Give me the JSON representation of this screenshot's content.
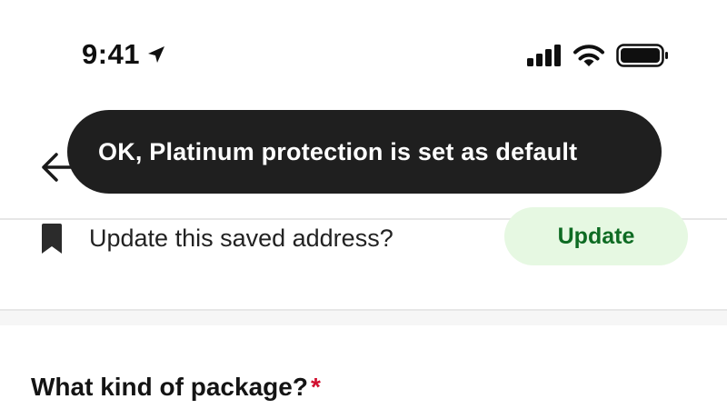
{
  "status_bar": {
    "time": "9:41",
    "icons": [
      "location-arrow-icon",
      "cellular-signal-icon",
      "wifi-icon",
      "battery-icon"
    ]
  },
  "header": {
    "back_icon": "back-arrow-icon"
  },
  "toast": {
    "message": "OK, Platinum protection is set as default"
  },
  "saved_address": {
    "icon": "bookmark-icon",
    "prompt": "Update this saved address?",
    "button_label": "Update"
  },
  "package_section": {
    "label": "What kind of package?",
    "required_marker": "*"
  },
  "colors": {
    "toast_bg": "#1f1f1f",
    "update_button_bg": "#e6f8e2",
    "update_button_text": "#0e6b23",
    "required": "#d10f2f"
  }
}
